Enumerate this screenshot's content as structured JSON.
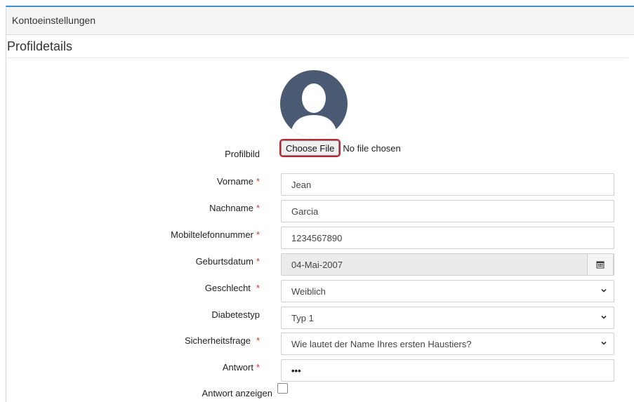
{
  "panel": {
    "title": "Kontoeinstellungen"
  },
  "section": {
    "title": "Profildetails"
  },
  "form": {
    "profile_picture": {
      "label": "Profilbild",
      "button": "Choose File",
      "status": "No file chosen"
    },
    "first_name": {
      "label": "Vorname",
      "required": "*",
      "value": "Jean"
    },
    "last_name": {
      "label": "Nachname",
      "required": "*",
      "value": "Garcia"
    },
    "mobile": {
      "label": "Mobiltelefonnummer",
      "required": "*",
      "value": "1234567890"
    },
    "birthdate": {
      "label": "Geburtsdatum",
      "required": "*",
      "value": "04-Mai-2007"
    },
    "gender": {
      "label": "Geschlecht",
      "required": "*",
      "value": "Weiblich"
    },
    "diabetes_type": {
      "label": "Diabetestyp",
      "value": "Typ 1"
    },
    "security_question": {
      "label": "Sicherheitsfrage",
      "required": "*",
      "value": "Wie lautet der Name Ihres ersten Haustiers?"
    },
    "answer": {
      "label": "Antwort",
      "required": "*",
      "value": "•••"
    },
    "show_answer": {
      "label": "Antwort anzeigen",
      "checked": false
    }
  },
  "colors": {
    "accent": "#3a8fd6",
    "required": "#d9342b",
    "highlight": "#c0262d",
    "avatar": "#4a5a72"
  }
}
